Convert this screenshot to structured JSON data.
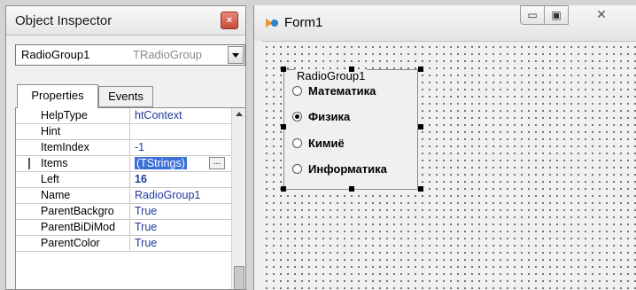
{
  "inspector": {
    "title": "Object Inspector",
    "close_glyph": "×",
    "component_name": "RadioGroup1",
    "component_type": "TRadioGroup",
    "tabs": [
      {
        "label": "Properties"
      },
      {
        "label": "Events"
      }
    ],
    "properties": [
      {
        "name": "HelpType",
        "value": "htContext"
      },
      {
        "name": "Hint",
        "value": ""
      },
      {
        "name": "ItemIndex",
        "value": "-1"
      },
      {
        "name": "Items",
        "value": "(TStrings)"
      },
      {
        "name": "Left",
        "value": "16"
      },
      {
        "name": "Name",
        "value": "RadioGroup1"
      },
      {
        "name": "ParentBackgro",
        "value": "True"
      },
      {
        "name": "ParentBiDiMod",
        "value": "True"
      },
      {
        "name": "ParentColor",
        "value": "True"
      }
    ],
    "ellipsis": "..."
  },
  "form": {
    "title": "Form1",
    "controls": {
      "minimize": "▭",
      "maximize": "▣",
      "close": "✕"
    },
    "radio_group": {
      "caption": "RadioGroup1",
      "items": [
        {
          "label": "Математика",
          "checked": false
        },
        {
          "label": "Физика",
          "checked": true
        },
        {
          "label": "Кимиё",
          "checked": false
        },
        {
          "label": "Информатика",
          "checked": false
        }
      ]
    }
  },
  "colors": {
    "selection": "#3a70d8",
    "value_text": "#1f3a9e",
    "close_red": "#c84a36"
  }
}
